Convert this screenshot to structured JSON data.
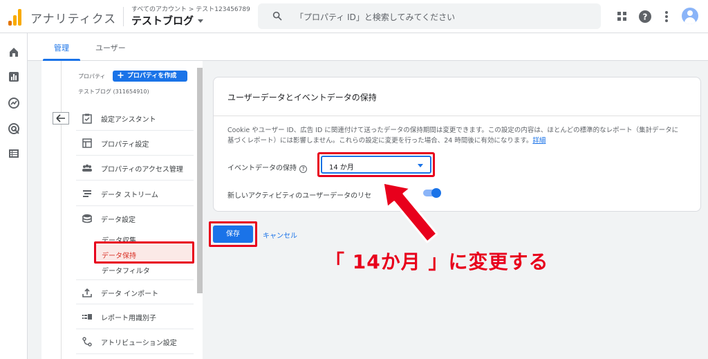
{
  "header": {
    "app_name": "アナリティクス",
    "breadcrumb": "すべてのアカウント > テスト123456789",
    "property_name": "テストブログ",
    "search_placeholder": "「プロパティ ID」と検索してみてください"
  },
  "tabs": [
    {
      "label": "管理",
      "active": true
    },
    {
      "label": "ユーザー",
      "active": false
    }
  ],
  "nav": {
    "property_label": "プロパティ",
    "create_button": "プロパティを作成",
    "property_id": "テストブログ (311654910)",
    "items": [
      {
        "label": "設定アシスタント",
        "icon": "checklist-icon"
      },
      {
        "label": "プロパティ設定",
        "icon": "layout-icon"
      },
      {
        "label": "プロパティのアクセス管理",
        "icon": "people-icon"
      },
      {
        "label": "データ ストリーム",
        "icon": "streams-icon"
      },
      {
        "label": "データ設定",
        "icon": "database-icon"
      },
      {
        "label": "データ インポート",
        "icon": "upload-icon"
      },
      {
        "label": "レポート用識別子",
        "icon": "identifier-icon"
      },
      {
        "label": "アトリビューション設定",
        "icon": "attribution-icon"
      }
    ],
    "sub_items": [
      {
        "label": "データ収集",
        "selected": false
      },
      {
        "label": "データ保持",
        "selected": true
      },
      {
        "label": "データフィルタ",
        "selected": false
      }
    ]
  },
  "card": {
    "title": "ユーザーデータとイベントデータの保持",
    "description": "Cookie やユーザー ID、広告 ID に関連付けて送ったデータの保持期間は変更できます。この設定の内容は、ほとんどの標準的なレポート（集計データに基づくレポート）には影響しません。これらの設定に変更を行った場合、24 時間後に有効になります。",
    "description_link": "詳細",
    "retention_label": "イベントデータの保持",
    "retention_value": "14 か月",
    "reset_label": "新しいアクティビティのユーザーデータのリセ",
    "reset_enabled": true
  },
  "actions": {
    "save": "保存",
    "cancel": "キャンセル"
  },
  "annotation": {
    "text": "「 14か月 」に変更する"
  },
  "colors": {
    "accent": "#1a73e8",
    "highlight": "#e8001c",
    "logo": "#f9ab00"
  }
}
